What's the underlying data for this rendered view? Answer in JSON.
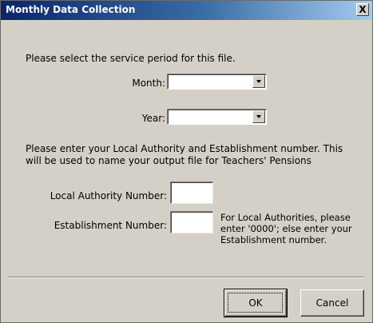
{
  "window": {
    "title": "Monthly Data Collection",
    "close_symbol": "X"
  },
  "period": {
    "instruction": "Please select the service period for this file.",
    "month_label": "Month:",
    "month_value": "",
    "year_label": "Year:",
    "year_value": ""
  },
  "identifiers": {
    "instruction": "Please enter your Local Authority and Establishment number.  This will be used to name your output file for Teachers' Pensions",
    "la_label": "Local Authority Number:",
    "la_value": "",
    "est_label": "Establishment Number:",
    "est_value": "",
    "est_hint": "For Local Authorities, please enter '0000'; else enter your Establishment number."
  },
  "buttons": {
    "ok": "OK",
    "cancel": "Cancel"
  }
}
